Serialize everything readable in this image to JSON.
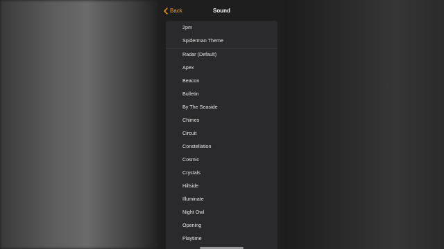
{
  "nav": {
    "back_label": "Back",
    "title": "Sound"
  },
  "sounds": {
    "custom": [
      "2pm",
      "Spiderman Theme"
    ],
    "builtin": [
      "Radar (Default)",
      "Apex",
      "Beacon",
      "Bulletin",
      "By The Seaside",
      "Chimes",
      "Circuit",
      "Constellation",
      "Cosmic",
      "Crystals",
      "Hillside",
      "Illuminate",
      "Night Owl",
      "Opening",
      "Playtime"
    ]
  },
  "colors": {
    "accent": "#ff9f0a",
    "background": "#1e1e1f",
    "card": "#2a2a2c",
    "text": "#e6e6e6"
  },
  "icons": {
    "back": "chevron-left-icon"
  }
}
